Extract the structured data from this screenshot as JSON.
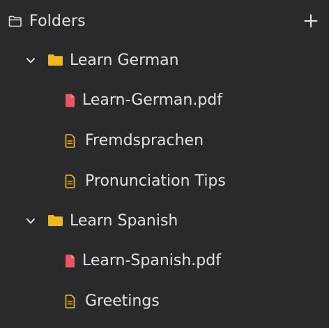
{
  "header": {
    "title": "Folders",
    "add_icon": "plus-icon",
    "folder_icon": "folder-open-outline-icon"
  },
  "colors": {
    "background": "#2a2a2c",
    "text": "#e2e2e2",
    "folder": "#f2b718",
    "pdf": "#f0545e",
    "note": "#f2b718"
  },
  "tree": [
    {
      "label": "Learn German",
      "expanded": true,
      "children": [
        {
          "label": "Learn-German.pdf",
          "kind": "pdf"
        },
        {
          "label": "Fremdsprachen",
          "kind": "note"
        },
        {
          "label": "Pronunciation Tips",
          "kind": "note"
        }
      ]
    },
    {
      "label": "Learn Spanish",
      "expanded": true,
      "children": [
        {
          "label": "Learn-Spanish.pdf",
          "kind": "pdf"
        },
        {
          "label": "Greetings",
          "kind": "note"
        }
      ]
    }
  ]
}
